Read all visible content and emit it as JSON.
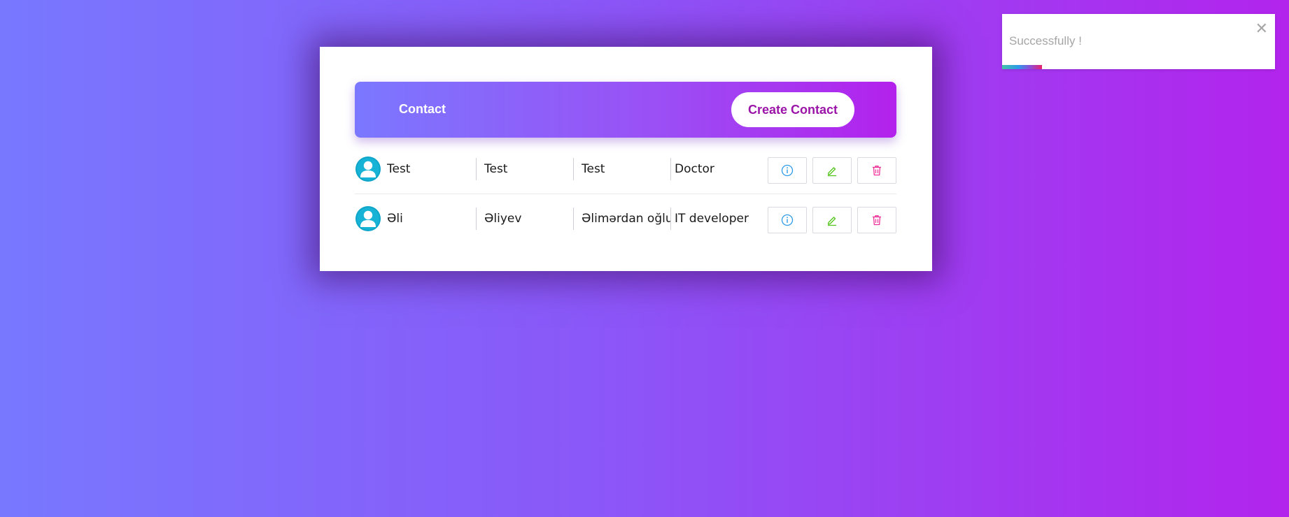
{
  "header": {
    "title": "Contact",
    "create_label": "Create Contact"
  },
  "contacts": [
    {
      "name": "Test",
      "surname": "Test",
      "father_name": "Test",
      "job": "Doctor"
    },
    {
      "name": "Əli",
      "surname": "Əliyev",
      "father_name": "Əlimərdan oğlu",
      "job": "IT developer"
    }
  ],
  "icons": {
    "avatar": "user-avatar-icon",
    "info": "info-icon",
    "edit": "pencil-icon",
    "delete": "trash-icon",
    "close": "close-icon"
  },
  "colors": {
    "accent_start": "#7878ff",
    "accent_end": "#b224ec",
    "create_text": "#9b14a8",
    "info": "#2d9be8",
    "edit": "#52c41a",
    "delete": "#eb2f96"
  },
  "toast": {
    "message": "Successfully !",
    "close_glyph": "✕",
    "progress": 0.145
  }
}
